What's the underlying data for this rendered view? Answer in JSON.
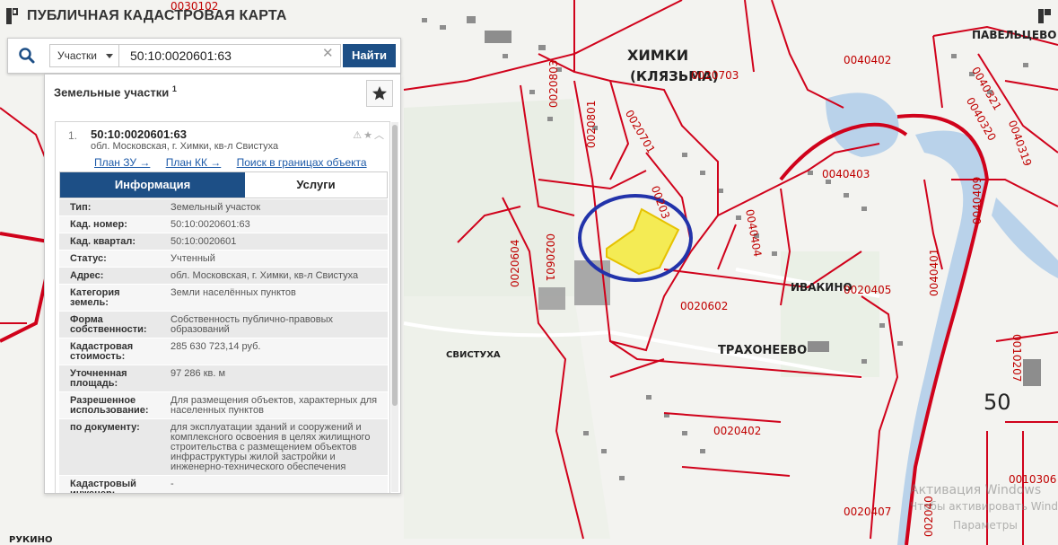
{
  "header": {
    "title": "ПУБЛИЧНАЯ КАДАСТРОВАЯ КАРТА"
  },
  "search": {
    "type_selected": "Участки",
    "query": "50:10:0020601:63",
    "find_label": "Найти",
    "clear_symbol": "✕"
  },
  "panel": {
    "title": "Земельные участки",
    "count": "1",
    "item": {
      "index": "1.",
      "cad_number": "50:10:0020601:63",
      "address": "обл. Московская, г. Химки, кв-л Свистуха",
      "links": [
        "План ЗУ →",
        "План КК →",
        "Поиск в границах объекта →"
      ],
      "tabs": [
        "Информация",
        "Услуги"
      ],
      "fields": [
        {
          "k": "Тип:",
          "v": "Земельный участок"
        },
        {
          "k": "Кад. номер:",
          "v": "50:10:0020601:63"
        },
        {
          "k": "Кад. квартал:",
          "v": "50:10:0020601"
        },
        {
          "k": "Статус:",
          "v": "Учтенный"
        },
        {
          "k": "Адрес:",
          "v": "обл. Московская, г. Химки, кв-л Свистуха"
        },
        {
          "k": "Категория земель:",
          "v": "Земли населённых пунктов"
        },
        {
          "k": "Форма собственности:",
          "v": "Собственность публично-правовых образований"
        },
        {
          "k": "Кадастровая стоимость:",
          "v": "285 630 723,14 руб."
        },
        {
          "k": "Уточненная площадь:",
          "v": "97 286 кв. м"
        },
        {
          "k": "Разрешенное использование:",
          "v": "Для размещения объектов, характерных для населенных пунктов"
        },
        {
          "k": "по документу:",
          "v": "для эксплуатации зданий и сооружений и комплексного освоения в целях жилищного строительства с размещением объектов инфраструктуры жилой застройки и инженерно-технического обеспечения"
        },
        {
          "k": "Кадастровый инженер:",
          "v": "-"
        }
      ]
    }
  },
  "map": {
    "places": [
      "ХИМКИ",
      "(КЛЯЗЬМА)",
      "ПАВЕЛЬЦЕВО",
      "ИВАКИНО",
      "ТРАХОНЕЕВО",
      "СВИСТУХА",
      "РУКИНО"
    ],
    "region": "50",
    "parcels": [
      "0030102",
      "0020803",
      "0020801",
      "0020701",
      "0020703",
      "00203",
      "0040402",
      "0040321",
      "0040320",
      "0040319",
      "0040403",
      "0040404",
      "0040409",
      "0040401",
      "0020405",
      "0020604",
      "0020601",
      "0020602",
      "0020402",
      "0010207",
      "0010306",
      "0020407",
      "002040"
    ],
    "highlight_color": "#f5e600",
    "circle_color": "#2233aa",
    "border_color": "#d0021b"
  },
  "watermark": [
    "Активация Windows",
    "Чтобы активировать Windows,",
    "Параметры"
  ]
}
